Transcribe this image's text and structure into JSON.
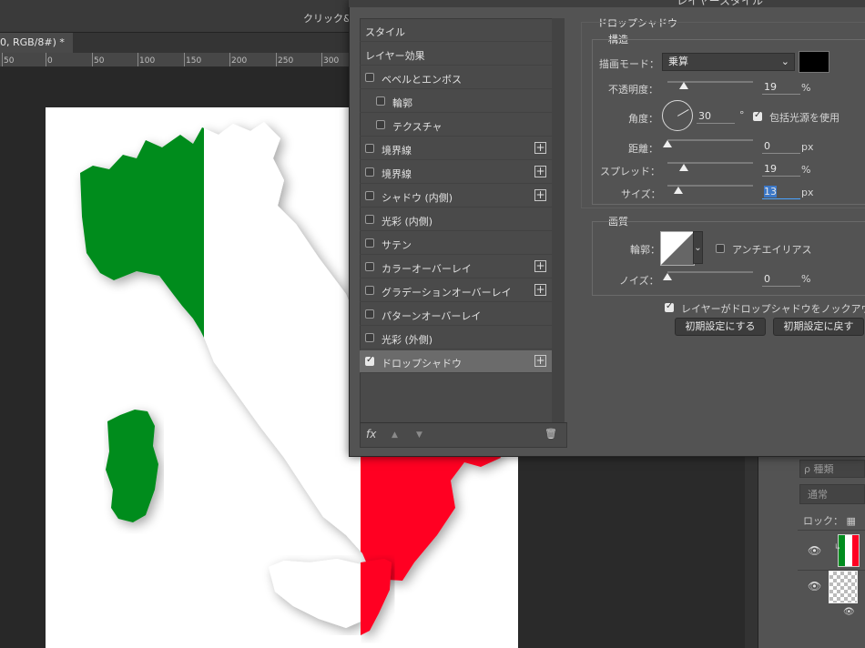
{
  "app": {
    "options_hint": "クリック&",
    "doc_tab": "0, RGB/8#) *",
    "ruler_ticks": [
      "50",
      "0",
      "50",
      "100",
      "150",
      "200",
      "250",
      "300"
    ]
  },
  "colors": {
    "italy_green": "#008c1e",
    "italy_red": "#ff0022",
    "shadow_swatch": "#000000"
  },
  "dialog": {
    "title": "レイヤースタイル",
    "list": {
      "styles": "スタイル",
      "blending": "レイヤー効果",
      "items": [
        {
          "label": "ベベルとエンボス",
          "checked": false,
          "plus": false,
          "indent": 0
        },
        {
          "label": "輪郭",
          "checked": false,
          "plus": false,
          "indent": 1
        },
        {
          "label": "テクスチャ",
          "checked": false,
          "plus": false,
          "indent": 1
        },
        {
          "label": "境界線",
          "checked": false,
          "plus": true,
          "indent": 0
        },
        {
          "label": "境界線",
          "checked": false,
          "plus": true,
          "indent": 0
        },
        {
          "label": "シャドウ (内側)",
          "checked": false,
          "plus": true,
          "indent": 0
        },
        {
          "label": "光彩 (内側)",
          "checked": false,
          "plus": false,
          "indent": 0
        },
        {
          "label": "サテン",
          "checked": false,
          "plus": false,
          "indent": 0
        },
        {
          "label": "カラーオーバーレイ",
          "checked": false,
          "plus": true,
          "indent": 0
        },
        {
          "label": "グラデーションオーバーレイ",
          "checked": false,
          "plus": true,
          "indent": 0
        },
        {
          "label": "パターンオーバーレイ",
          "checked": false,
          "plus": false,
          "indent": 0
        },
        {
          "label": "光彩 (外側)",
          "checked": false,
          "plus": false,
          "indent": 0
        },
        {
          "label": "ドロップシャドウ",
          "checked": true,
          "plus": true,
          "indent": 0,
          "selected": true
        }
      ],
      "footer": {
        "fx_icon": "fx",
        "up_icon": "▲",
        "down_icon": "▼",
        "trash_icon": "🗑"
      }
    },
    "drop_shadow": {
      "section_title": "ドロップシャドウ",
      "structure": {
        "title": "構造",
        "blend_mode_label": "描画モード：",
        "blend_mode_value": "乗算",
        "opacity_label": "不透明度：",
        "opacity_value": "19",
        "opacity_unit": "%",
        "opacity_level": 19,
        "angle_label": "角度：",
        "angle_value": "30",
        "angle_unit": "°",
        "global_light_label": "包括光源を使用",
        "global_light_checked": true,
        "distance_label": "距離：",
        "distance_value": "0",
        "distance_unit": "px",
        "distance_level": 0,
        "spread_label": "スプレッド：",
        "spread_value": "19",
        "spread_unit": "%",
        "spread_level": 19,
        "size_label": "サイズ：",
        "size_value": "13",
        "size_unit": "px",
        "size_level": 13
      },
      "quality": {
        "title": "画質",
        "contour_label": "輪郭：",
        "antialias_label": "アンチエイリアス",
        "antialias_checked": false,
        "noise_label": "ノイズ：",
        "noise_value": "0",
        "noise_unit": "%",
        "noise_level": 0
      },
      "knockout_label": "レイヤーがドロップシャドウをノックアウ",
      "knockout_checked": true,
      "make_default_btn": "初期設定にする",
      "reset_default_btn": "初期設定に戻す"
    }
  },
  "layers_panel": {
    "filter_placeholder": "ρ 種類",
    "blend_mode": "通常",
    "lock_label": "ロック："
  }
}
